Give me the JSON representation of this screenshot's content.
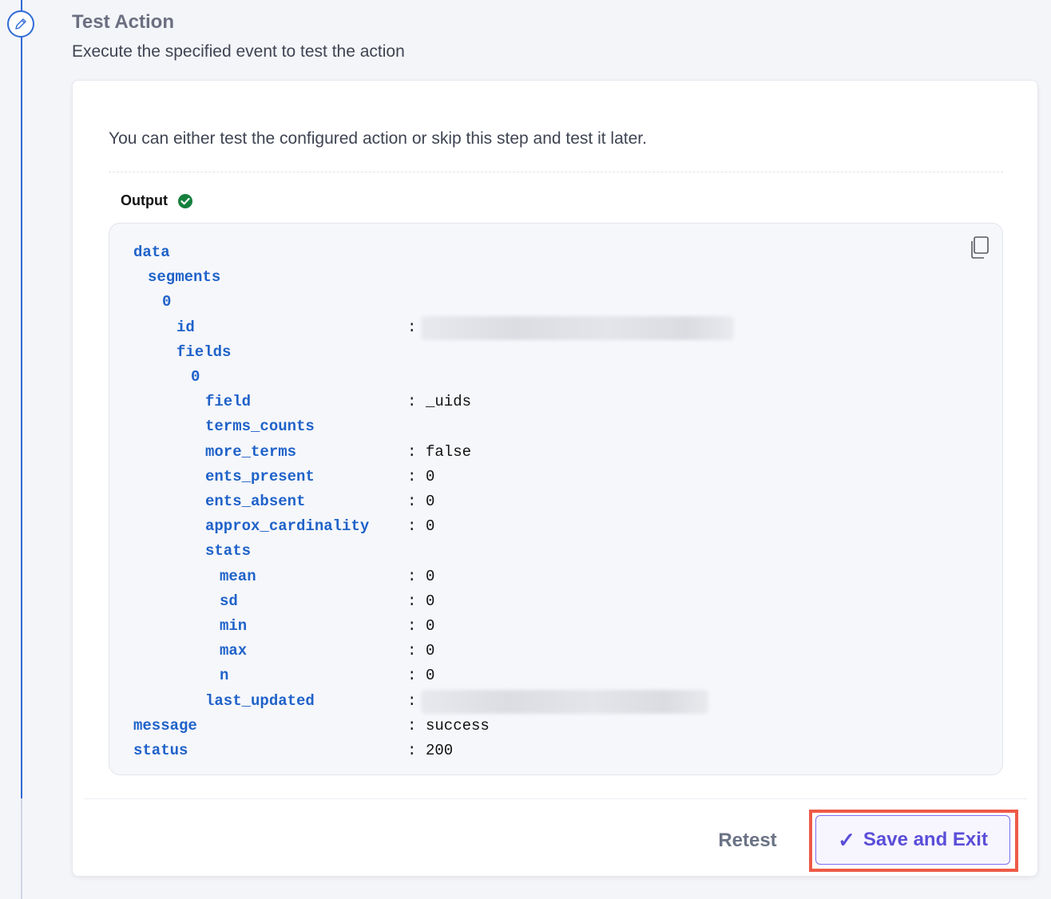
{
  "step": {
    "title": "Test Action",
    "description": "Execute the specified event to test the action",
    "icon": "pencil-icon"
  },
  "card": {
    "intro": "You can either test the configured action or skip this step and test it later.",
    "output_label": "Output",
    "output_status_icon": "check-circle-icon",
    "output_status_color": "#15803d"
  },
  "output": {
    "separator": ":",
    "rows": [
      {
        "key": "data",
        "value": null
      },
      {
        "key": "segments",
        "value": null
      },
      {
        "key": "0",
        "value": null
      },
      {
        "key": "id",
        "value": "",
        "redacted": true
      },
      {
        "key": "fields",
        "value": null
      },
      {
        "key": "0",
        "value": null
      },
      {
        "key": "field",
        "value": "_uids"
      },
      {
        "key": "terms_counts",
        "value": null
      },
      {
        "key": "more_terms",
        "value": "false"
      },
      {
        "key": "ents_present",
        "value": "0"
      },
      {
        "key": "ents_absent",
        "value": "0"
      },
      {
        "key": "approx_cardinality",
        "value": "0"
      },
      {
        "key": "stats",
        "value": null
      },
      {
        "key": "mean",
        "value": "0"
      },
      {
        "key": "sd",
        "value": "0"
      },
      {
        "key": "min",
        "value": "0"
      },
      {
        "key": "max",
        "value": "0"
      },
      {
        "key": "n",
        "value": "0"
      },
      {
        "key": "last_updated",
        "value": "",
        "redacted": true
      },
      {
        "key": "message",
        "value": "success"
      },
      {
        "key": "status",
        "value": "200"
      }
    ]
  },
  "actions": {
    "retest_label": "Retest",
    "save_exit_label": "Save and Exit",
    "save_exit_icon": "checkmark-icon"
  },
  "colors": {
    "accent": "#2f6bd6",
    "key_blue": "#1f62c9",
    "save_purple": "#5b4fd8",
    "highlight_red": "#ee5a47"
  }
}
